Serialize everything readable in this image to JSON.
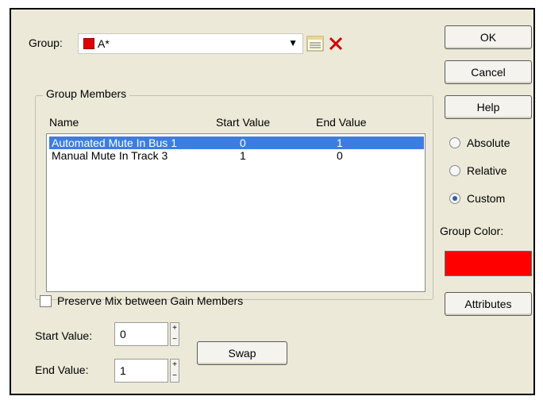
{
  "group": {
    "label": "Group:",
    "value": "A*",
    "color": "#e00000"
  },
  "members": {
    "title": "Group Members",
    "columns": [
      "Name",
      "Start Value",
      "End Value"
    ],
    "rows": [
      {
        "name": "Automated Mute In Bus 1",
        "start": "0",
        "end": "1",
        "selected": true
      },
      {
        "name": "Manual Mute In Track 3",
        "start": "1",
        "end": "0",
        "selected": false
      }
    ]
  },
  "options": {
    "preserve_label": "Preserve Mix between Gain Members",
    "start_label": "Start Value:",
    "start_value": "0",
    "end_label": "End Value:",
    "end_value": "1",
    "swap_label": "Swap"
  },
  "buttons": {
    "ok": "OK",
    "cancel": "Cancel",
    "help": "Help",
    "attributes": "Attributes"
  },
  "mode": {
    "absolute": "Absolute",
    "relative": "Relative",
    "custom": "Custom",
    "selected": "custom"
  },
  "group_color": {
    "label": "Group Color:",
    "value": "#ff0000"
  }
}
